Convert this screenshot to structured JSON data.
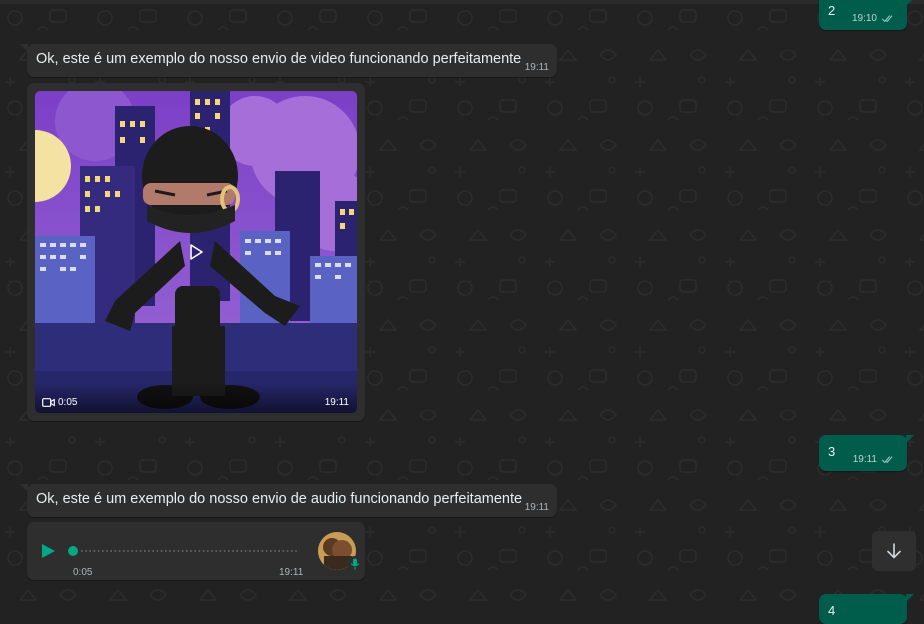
{
  "messages": {
    "out_2": {
      "text": "2",
      "time": "19:10"
    },
    "video_caption": {
      "text": "Ok, este é um exemplo do nosso envio de video funcionando perfeitamente",
      "time": "19:11"
    },
    "video": {
      "duration": "0:05",
      "time": "19:11"
    },
    "out_3": {
      "text": "3",
      "time": "19:11"
    },
    "audio_caption": {
      "text": "Ok, este é um exemplo do nosso envio de audio funcionando perfeitamente",
      "time": "19:11"
    },
    "audio": {
      "duration": "0:05",
      "time": "19:11",
      "progress": 0
    },
    "out_4": {
      "text": "4"
    }
  },
  "colors": {
    "background": "#222222",
    "incoming_bubble": "#2e2e2e",
    "outgoing_bubble": "#005c4b",
    "accent": "#00a884"
  },
  "icons": [
    "double-check-icon",
    "video-camera-icon",
    "play-icon",
    "microphone-icon",
    "arrow-down-icon"
  ]
}
